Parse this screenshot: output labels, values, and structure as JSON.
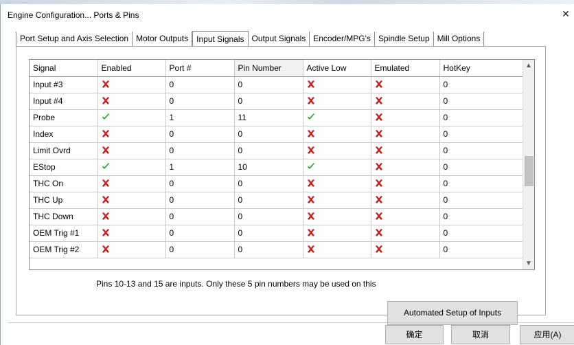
{
  "window": {
    "title": "Engine Configuration... Ports & Pins",
    "close_glyph": "✕"
  },
  "tabs": [
    {
      "label": "Port Setup and Axis Selection",
      "active": false
    },
    {
      "label": "Motor Outputs",
      "active": false
    },
    {
      "label": "Input Signals",
      "active": true
    },
    {
      "label": "Output Signals",
      "active": false
    },
    {
      "label": "Encoder/MPG's",
      "active": false
    },
    {
      "label": "Spindle Setup",
      "active": false
    },
    {
      "label": "Mill Options",
      "active": false
    }
  ],
  "grid": {
    "columns": [
      "Signal",
      "Enabled",
      "Port #",
      "Pin Number",
      "Active Low",
      "Emulated",
      "HotKey"
    ],
    "sorted_column": "Pin Number",
    "rows": [
      {
        "signal": "Input #3",
        "enabled": false,
        "port": "0",
        "pin": "0",
        "active_low": false,
        "emulated": false,
        "hotkey": "0"
      },
      {
        "signal": "Input #4",
        "enabled": false,
        "port": "0",
        "pin": "0",
        "active_low": false,
        "emulated": false,
        "hotkey": "0"
      },
      {
        "signal": "Probe",
        "enabled": true,
        "port": "1",
        "pin": "11",
        "active_low": true,
        "emulated": false,
        "hotkey": "0"
      },
      {
        "signal": "Index",
        "enabled": false,
        "port": "0",
        "pin": "0",
        "active_low": false,
        "emulated": false,
        "hotkey": "0"
      },
      {
        "signal": "Limit Ovrd",
        "enabled": false,
        "port": "0",
        "pin": "0",
        "active_low": false,
        "emulated": false,
        "hotkey": "0"
      },
      {
        "signal": "EStop",
        "enabled": true,
        "port": "1",
        "pin": "10",
        "active_low": true,
        "emulated": false,
        "hotkey": "0"
      },
      {
        "signal": "THC On",
        "enabled": false,
        "port": "0",
        "pin": "0",
        "active_low": false,
        "emulated": false,
        "hotkey": "0"
      },
      {
        "signal": "THC Up",
        "enabled": false,
        "port": "0",
        "pin": "0",
        "active_low": false,
        "emulated": false,
        "hotkey": "0"
      },
      {
        "signal": "THC Down",
        "enabled": false,
        "port": "0",
        "pin": "0",
        "active_low": false,
        "emulated": false,
        "hotkey": "0"
      },
      {
        "signal": "OEM Trig #1",
        "enabled": false,
        "port": "0",
        "pin": "0",
        "active_low": false,
        "emulated": false,
        "hotkey": "0"
      },
      {
        "signal": "OEM Trig #2",
        "enabled": false,
        "port": "0",
        "pin": "0",
        "active_low": false,
        "emulated": false,
        "hotkey": "0"
      }
    ],
    "colors": {
      "check": "#2aa02a",
      "cross": "#c81e1e"
    },
    "icons": {
      "yes": "check-icon",
      "no": "cross-icon"
    }
  },
  "info_text": "Pins 10-13 and 15 are inputs. Only these 5 pin numbers may be used on this",
  "buttons": {
    "automated_setup": "Automated Setup of Inputs",
    "ok": "确定",
    "cancel": "取消",
    "apply": "应用(A)"
  }
}
